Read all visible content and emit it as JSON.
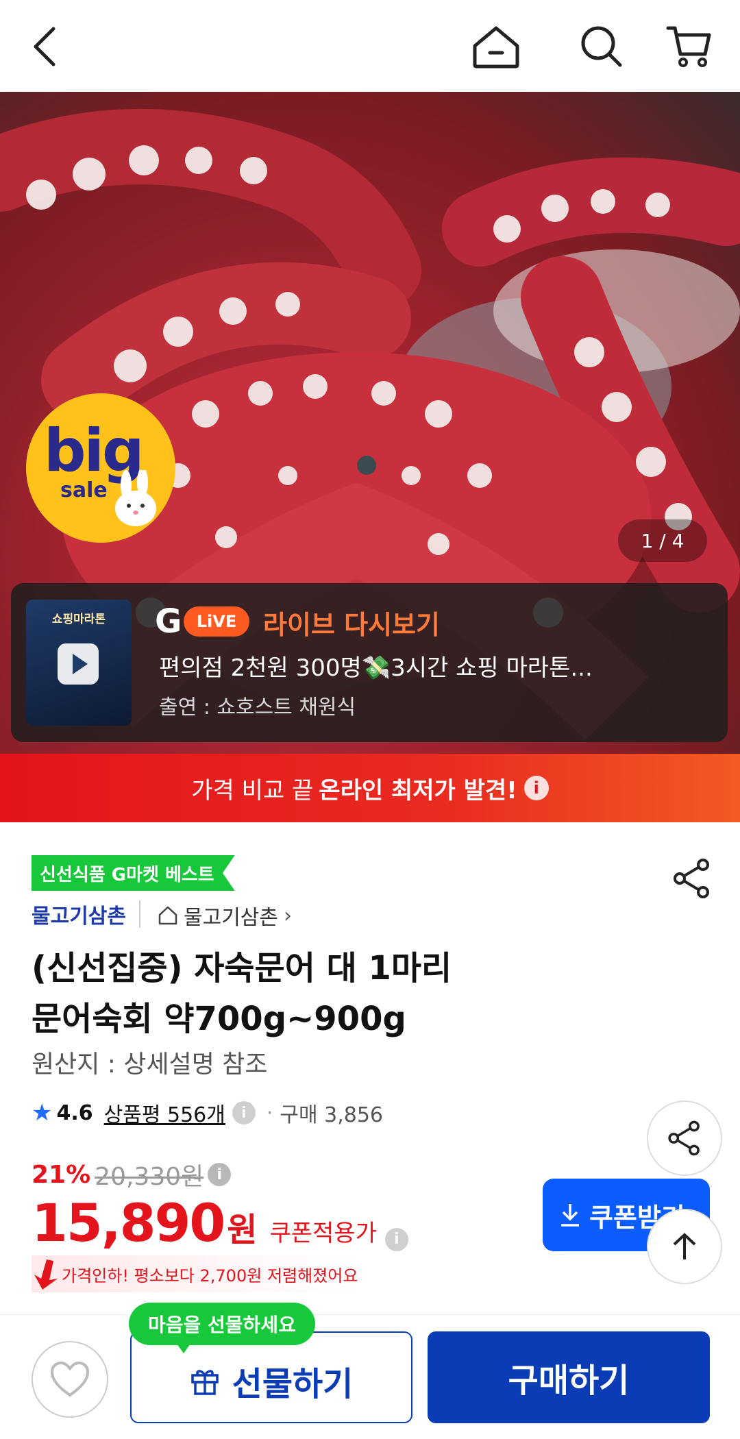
{
  "header": {
    "icons": [
      "back-icon",
      "home-icon",
      "search-icon",
      "cart-icon"
    ]
  },
  "hero": {
    "badge_big": "big",
    "badge_sale": "sale",
    "page_indicator": "1 / 4",
    "live": {
      "thumb_title": "쇼핑마라톤",
      "logo_g": "G",
      "logo_live": "LiVE",
      "title": "라이브 다시보기",
      "description": "편의점 2천원 300명💸3시간 쇼핑 마라톤...",
      "host": "출연 : 쇼호스트 채원식"
    }
  },
  "banner": {
    "lead": "가격 비교 끝",
    "strong": "온라인 최저가 발견!",
    "info_icon": "i"
  },
  "product": {
    "best_tag": "신선식품 G마켓 베스트",
    "seller": "물고기삼촌",
    "store_link": "물고기삼촌",
    "title_line1": "(신선집중) 자숙문어 대 1마리",
    "title_line2": "문어숙회 약700g~900g",
    "origin": "원산지 : 상세설명 참조",
    "rating": "4.6",
    "reviews": "상품평 556개",
    "purchases": "구매 3,856",
    "discount_pct": "21%",
    "original_price": "20,330원",
    "price": "15,890",
    "price_unit": "원",
    "coupon_price_label": "쿠폰적용가",
    "coupon_button": "쿠폰받기",
    "price_drop_note": "가격인하! 평소보다 2,700원 저렴해졌어요"
  },
  "bottom": {
    "gift_bubble": "마음을 선물하세요",
    "gift_button": "선물하기",
    "buy_button": "구매하기"
  },
  "colors": {
    "accent_red": "#e3141c",
    "accent_blue": "#0a5cff",
    "navy": "#0a3cb5",
    "green": "#17c83a",
    "live_orange": "#ff7a38"
  }
}
